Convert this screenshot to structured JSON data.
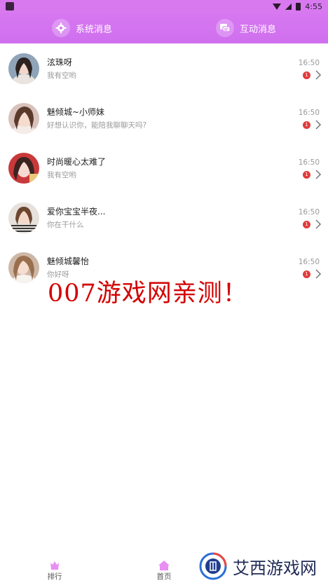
{
  "status_bar": {
    "time": "4:55"
  },
  "header": {
    "tabs": [
      {
        "label": "系统消息",
        "icon": "gear-icon"
      },
      {
        "label": "互动消息",
        "icon": "chat-icon"
      }
    ]
  },
  "messages": [
    {
      "name": "泫珠呀",
      "preview": "我有空哟",
      "time": "16:50",
      "unread": "1"
    },
    {
      "name": "魅倾城~小师妹",
      "preview": "好想认识你，能陪我聊聊天吗?",
      "time": "16:50",
      "unread": "1"
    },
    {
      "name": "时尚暖心太难了",
      "preview": "我有空哟",
      "time": "16:50",
      "unread": "1"
    },
    {
      "name": "爱你宝宝半夜...",
      "preview": "你在干什么",
      "time": "16:50",
      "unread": "1"
    },
    {
      "name": "魅倾城馨怡",
      "preview": "你好呀",
      "time": "16:50",
      "unread": "1"
    }
  ],
  "watermark": "007游戏网亲测！",
  "bottom_nav": [
    {
      "label": "排行",
      "icon": "trophy-icon"
    },
    {
      "label": "首页",
      "icon": "home-icon"
    }
  ],
  "logo": {
    "text": "艾西游戏网"
  },
  "colors": {
    "header": "#d778f1",
    "badge": "#e23b3b",
    "watermark": "#d40000"
  }
}
